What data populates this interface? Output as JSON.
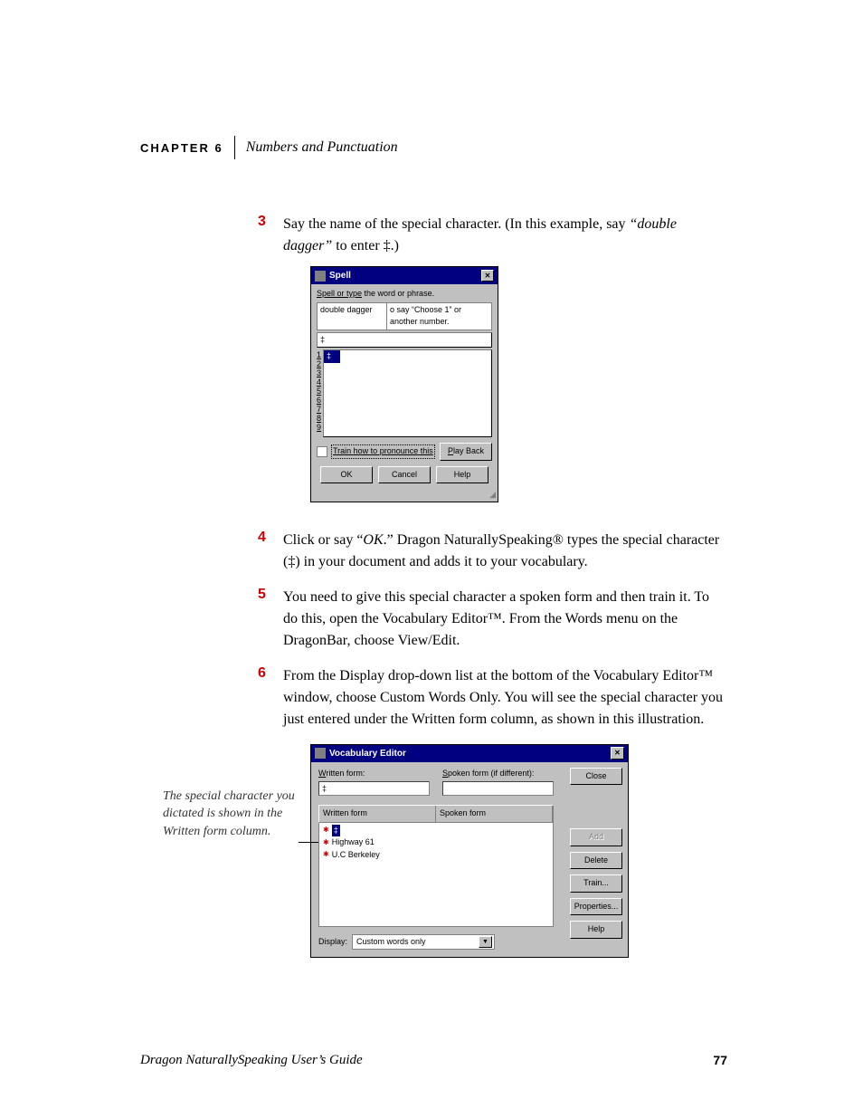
{
  "header": {
    "chapter_label": "CHAPTER 6",
    "chapter_title": "Numbers and Punctuation"
  },
  "steps": {
    "s3_num": "3",
    "s3_a": "Say the name of the special character. (In this example, say ",
    "s3_b": "“double dagger”",
    "s3_c": " to enter ‡.)",
    "s4_num": "4",
    "s4_a": "Click or say “",
    "s4_b": "OK",
    "s4_c": ".” Dragon NaturallySpeaking® types the special character (‡) in your document and adds it to your vocabulary.",
    "s5_num": "5",
    "s5_text": "You need to give this special character a spoken form and then train it. To do this, open the Vocabulary Editor™. From the Words menu on the DragonBar, choose View/Edit.",
    "s6_num": "6",
    "s6_text": "From the Display drop-down list at the bottom of the Vocabulary Editor™ window, choose Custom Words Only. You will see the special character you just entered under the Written form column, as shown in this illustration."
  },
  "spell": {
    "title": "Spell",
    "label_a": "Spell or type",
    "label_b": " the word or phrase.",
    "input_left": "double dagger",
    "input_right": "o say “Choose 1” or another number.",
    "result": "‡",
    "nums": [
      "1",
      "2",
      "3",
      "4",
      "5",
      "6",
      "7",
      "8",
      "9"
    ],
    "choice_item": "‡",
    "train_link": "Train how to pronounce this",
    "play_back": "Play Back",
    "ok": "OK",
    "cancel": "Cancel",
    "help": "Help"
  },
  "vocab": {
    "title": "Vocabulary Editor",
    "written_label_u": "W",
    "written_label_rest": "ritten form:",
    "spoken_label_u": "S",
    "spoken_label_rest": "poken form (if different):",
    "written_value": "‡",
    "col1": "Written form",
    "col2": "Spoken form",
    "rows": [
      {
        "w": "‡",
        "selected": true
      },
      {
        "w": "Highway 61"
      },
      {
        "w": "U.C Berkeley"
      }
    ],
    "display_label": "Display:",
    "display_value": "Custom words only",
    "btn_close_u": "C",
    "btn_close_rest": "lose",
    "btn_add": "Add",
    "btn_delete_u": "D",
    "btn_delete_rest": "elete",
    "btn_train_u": "T",
    "btn_train_rest": "rain...",
    "btn_props_u": "P",
    "btn_props_rest": "roperties...",
    "btn_help_u": "H",
    "btn_help_rest": "elp"
  },
  "caption": "The special character you dictated is shown in the Written form column.",
  "footer": {
    "left": "Dragon NaturallySpeaking User’s Guide",
    "right": "77"
  }
}
